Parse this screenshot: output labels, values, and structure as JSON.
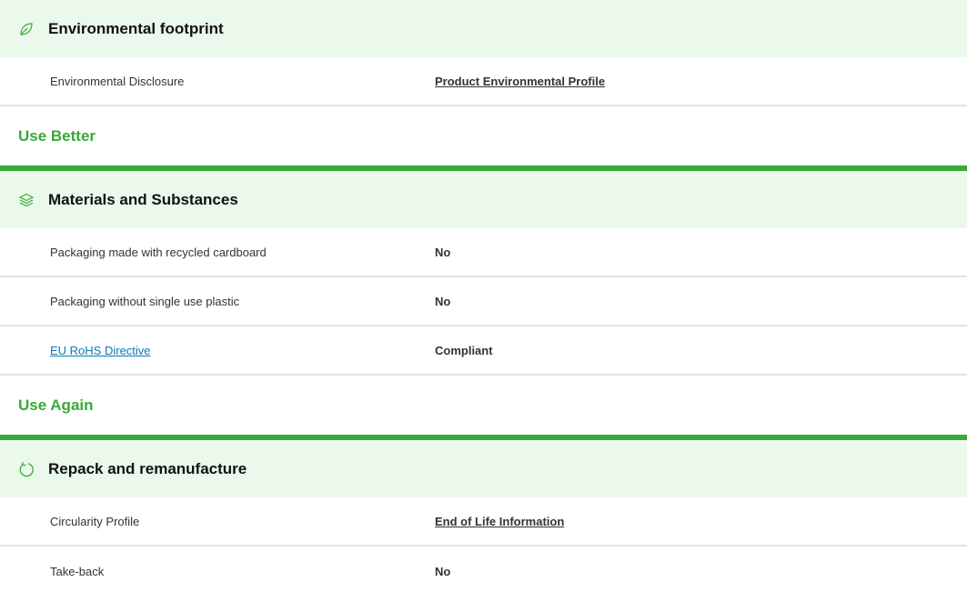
{
  "sections": [
    {
      "title": "Environmental footprint",
      "icon": "leaf-icon",
      "rows": [
        {
          "label": "Environmental Disclosure",
          "value": "Product Environmental Profile"
        }
      ]
    },
    {
      "title": "Materials and Substances",
      "icon": "layers-icon",
      "rows": [
        {
          "label": "Packaging made with recycled cardboard",
          "value": "No"
        },
        {
          "label": "Packaging without single use plastic",
          "value": "No"
        },
        {
          "label": "EU RoHS Directive",
          "value": "Compliant"
        }
      ]
    },
    {
      "title": "Repack and remanufacture",
      "icon": "refresh-icon",
      "rows": [
        {
          "label": "Circularity Profile",
          "value": "End of Life Information"
        },
        {
          "label": "Take-back",
          "value": "No"
        }
      ]
    }
  ],
  "groups": {
    "use_better": "Use Better",
    "use_again": "Use Again"
  },
  "colors": {
    "accent_green": "#3aa935",
    "header_bg": "#ebf8ec",
    "link_blue": "#0b7ab4"
  }
}
